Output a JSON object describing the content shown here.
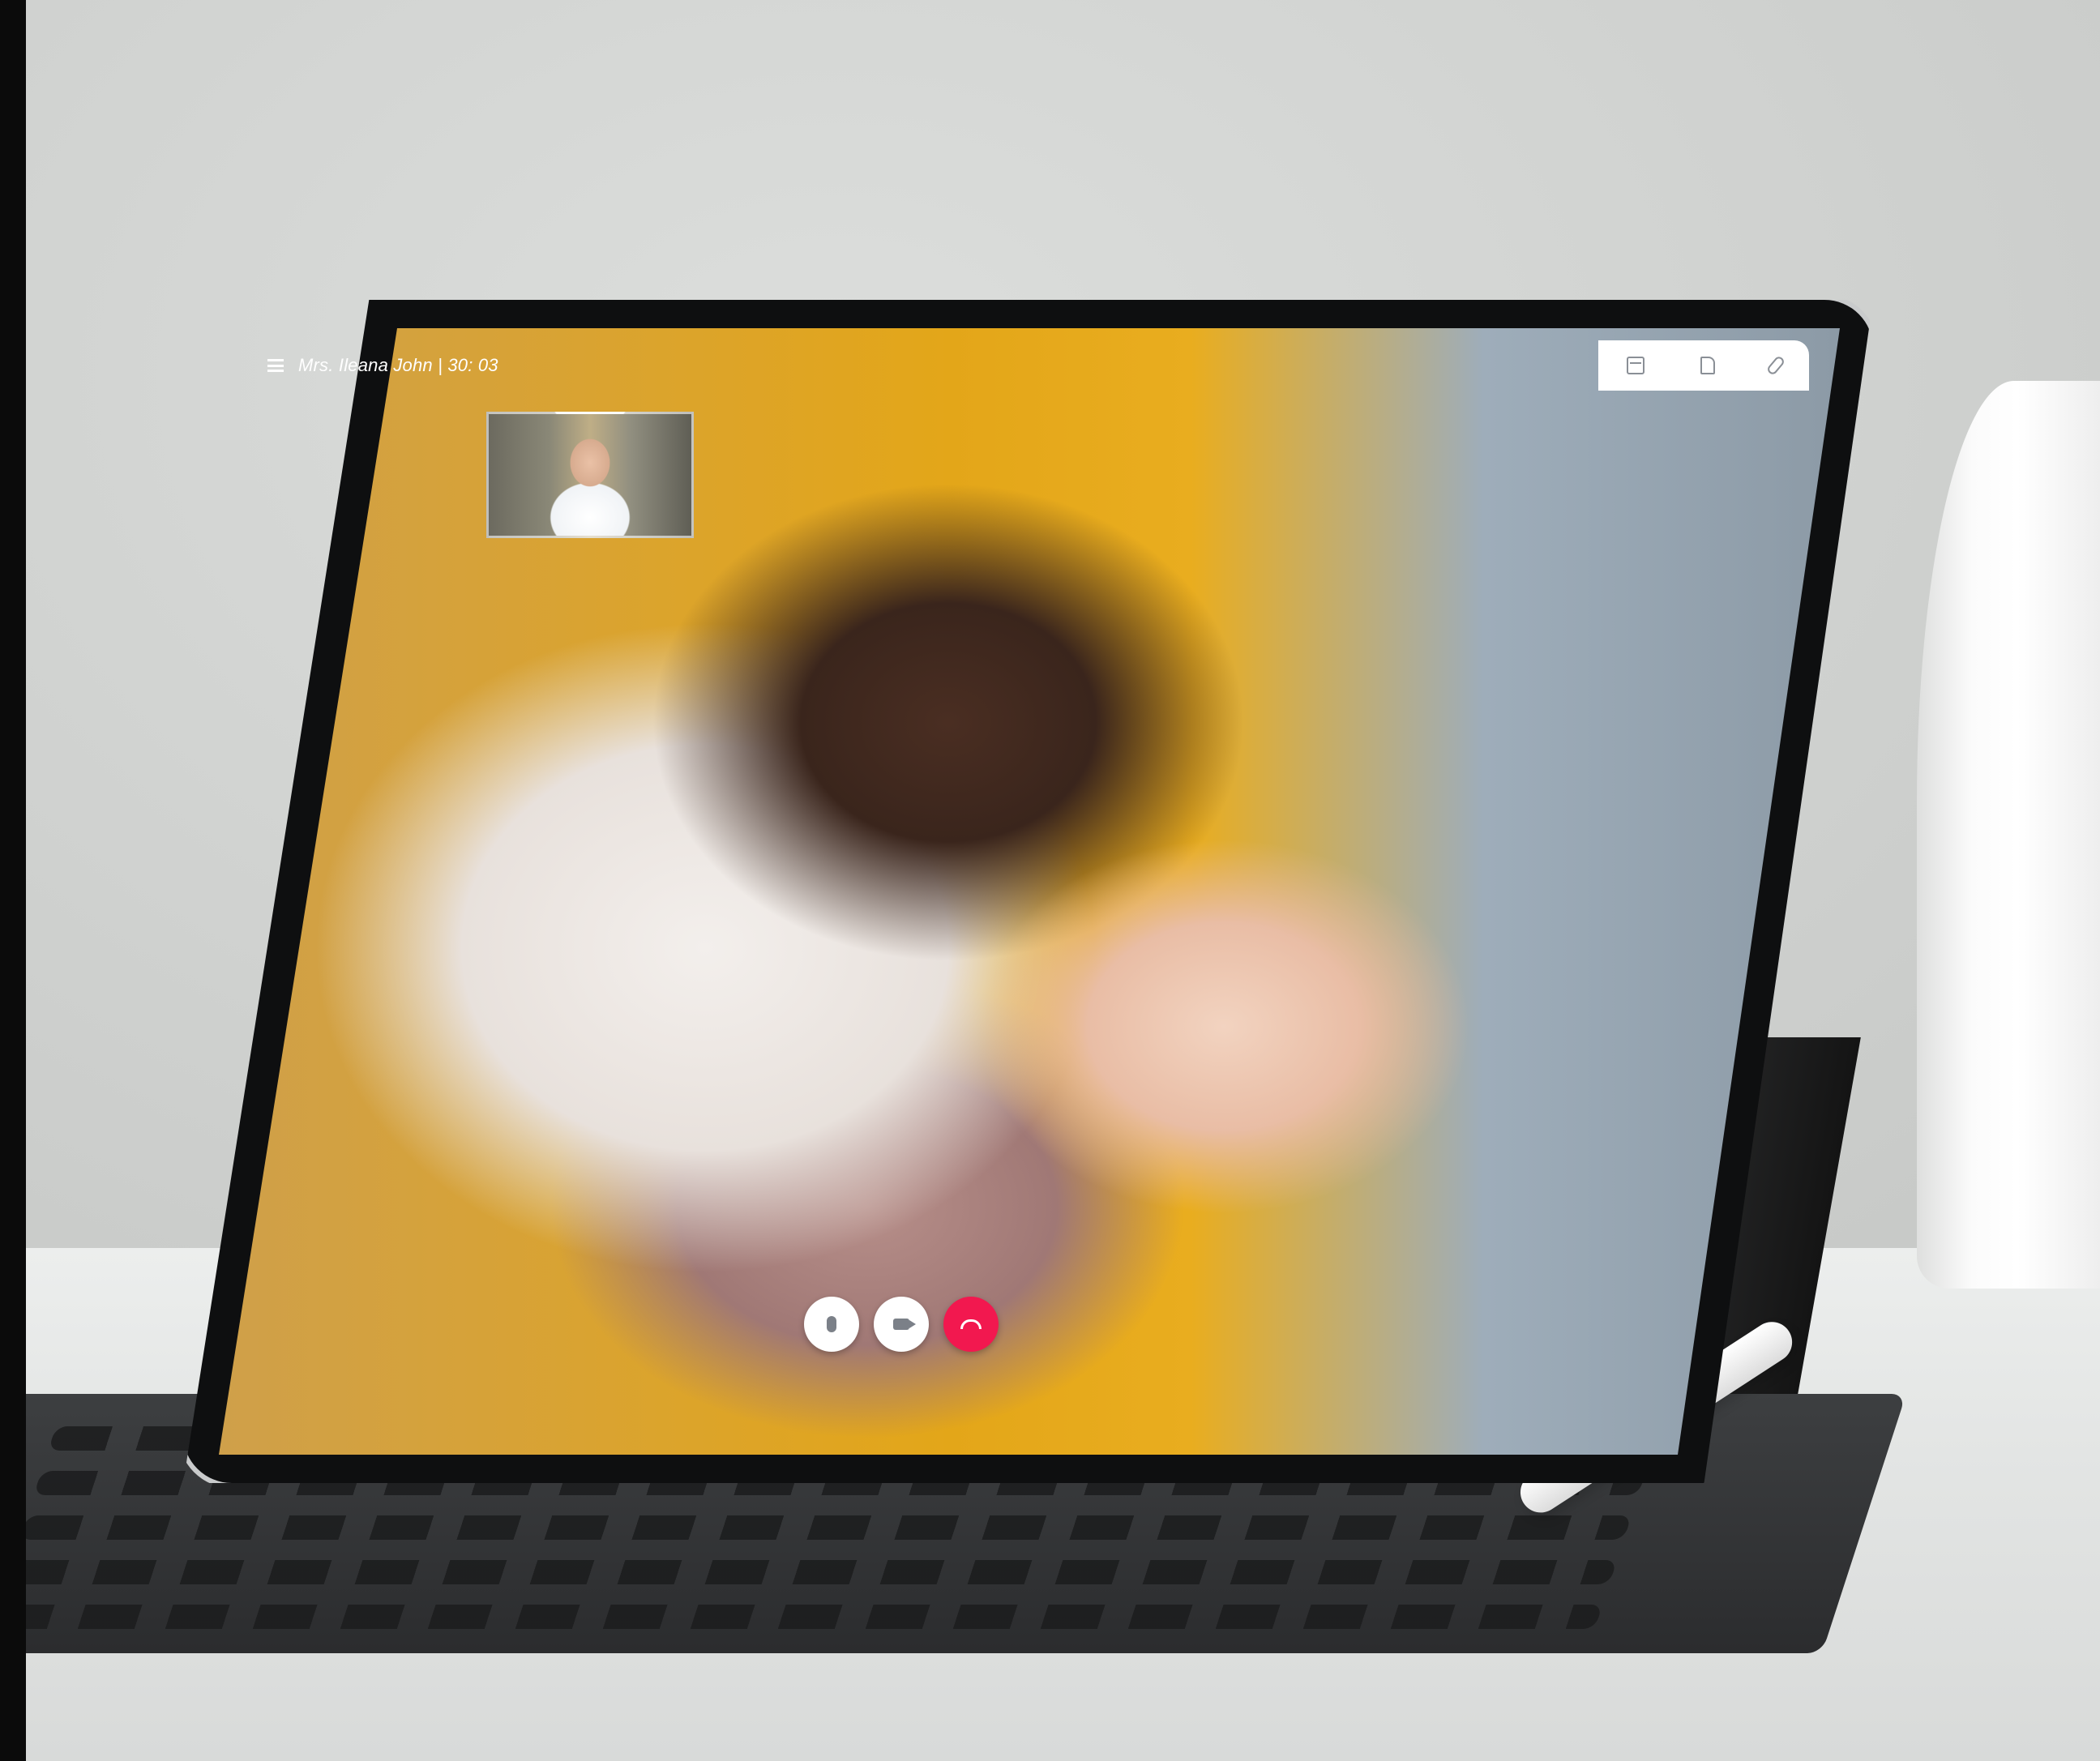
{
  "call": {
    "caller_label": "Mrs. Ileana John | 30: 03"
  },
  "toolbar": {
    "icons": [
      "calendar-icon",
      "document-icon",
      "paperclip-icon"
    ]
  },
  "controls": {
    "icons": [
      "microphone-icon",
      "video-camera-icon",
      "end-call-icon"
    ],
    "end_call_color": "#f2184f"
  }
}
